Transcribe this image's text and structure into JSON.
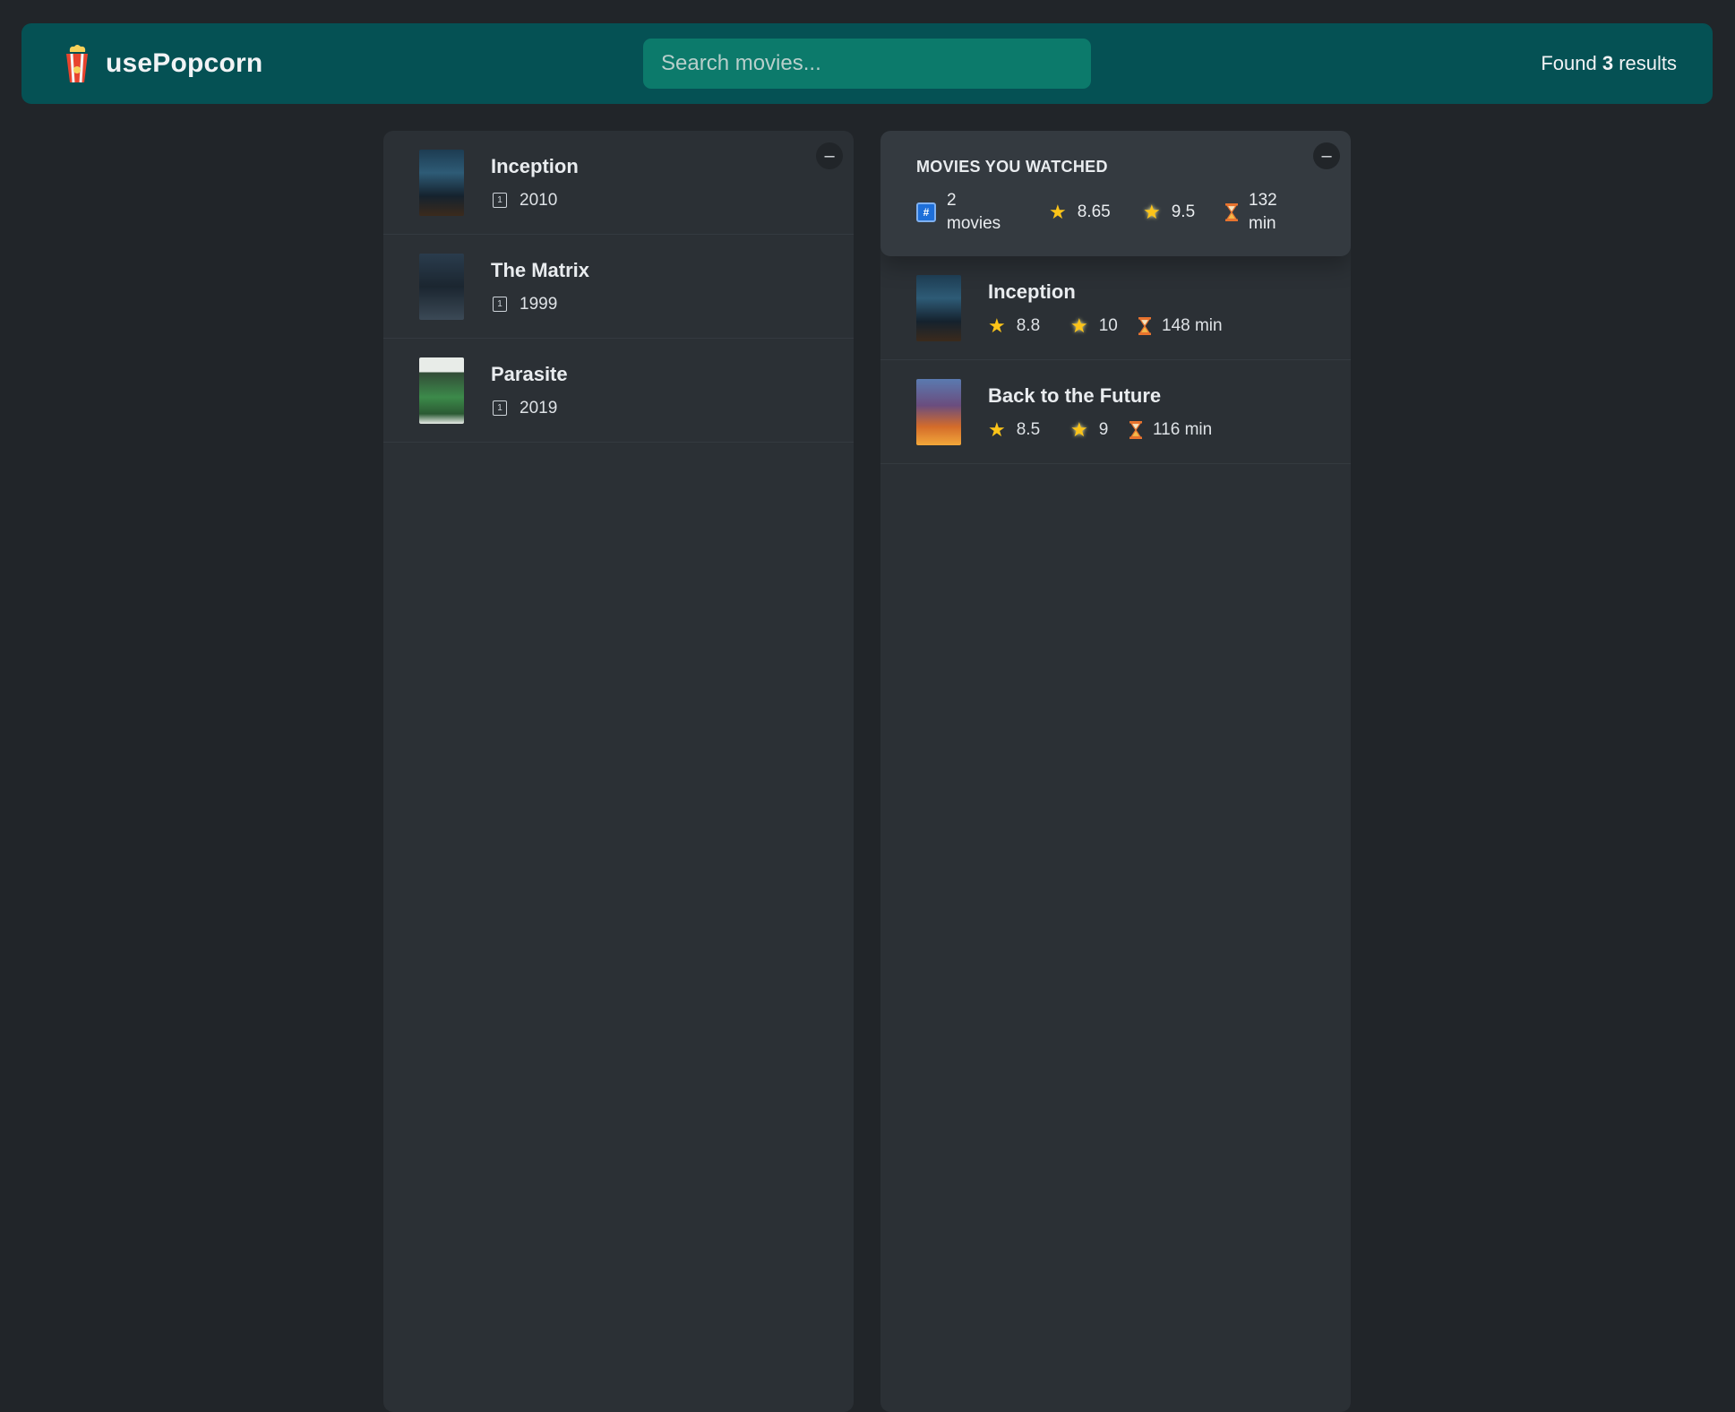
{
  "navbar": {
    "app_name": "usePopcorn",
    "search_placeholder": "Search movies...",
    "results_prefix": "Found ",
    "results_count": "3",
    "results_suffix": " results"
  },
  "search_list": {
    "toggle_label": "–",
    "movies": [
      {
        "title": "Inception",
        "year": "2010",
        "poster": "inception-poster"
      },
      {
        "title": "The Matrix",
        "year": "1999",
        "poster": "matrix-poster"
      },
      {
        "title": "Parasite",
        "year": "2019",
        "poster": "parasite-poster"
      }
    ]
  },
  "watched": {
    "toggle_label": "–",
    "summary": {
      "title": "MOVIES YOU WATCHED",
      "count": "2",
      "count_unit": "movies",
      "avg_imdb_rating": "8.65",
      "avg_user_rating": "9.5",
      "avg_runtime": "132",
      "runtime_unit": "min"
    },
    "movies": [
      {
        "title": "Inception",
        "imdb_rating": "8.8",
        "user_rating": "10",
        "runtime": "148 min",
        "poster": "inception-poster"
      },
      {
        "title": "Back to the Future",
        "imdb_rating": "8.5",
        "user_rating": "9",
        "runtime": "116 min",
        "poster": "back-to-the-future-poster"
      }
    ]
  },
  "icons": {
    "logo": "popcorn-icon",
    "year": "calendar-icon",
    "count": "hash-icon",
    "imdb": "star-icon",
    "user": "glowing-star-icon",
    "runtime": "hourglass-icon"
  },
  "colors": {
    "navbar_bg": "#055154",
    "search_bg": "#0c7a6b",
    "page_bg": "#212529",
    "box_bg": "#2b3035",
    "summary_bg": "#343a40",
    "star": "#fcc419"
  }
}
